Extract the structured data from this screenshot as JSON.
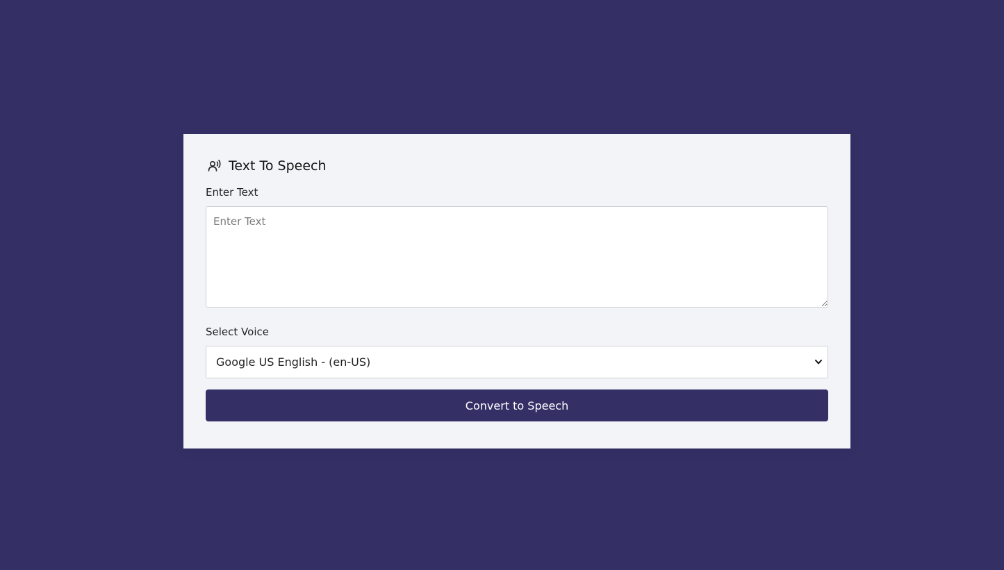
{
  "app": {
    "title": "Text To Speech",
    "icon": "speaker-person-icon"
  },
  "form": {
    "text_label": "Enter Text",
    "text_placeholder": "Enter Text",
    "text_value": "",
    "voice_label": "Select Voice",
    "voice_selected": "Google US English - (en-US)",
    "convert_label": "Convert to Speech"
  },
  "colors": {
    "background": "#343066",
    "card": "#f3f4f8",
    "button": "#343066"
  }
}
